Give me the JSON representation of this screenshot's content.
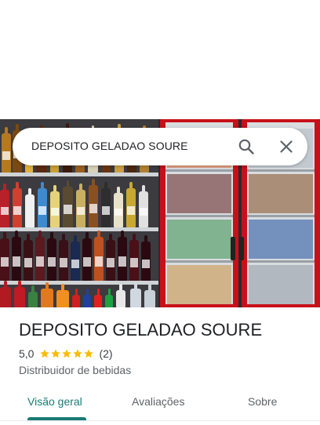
{
  "search": {
    "query": "DEPOSITO GELADAO SOURE",
    "search_icon": "search-icon",
    "close_icon": "close-icon"
  },
  "place": {
    "name": "DEPOSITO GELADAO SOURE",
    "rating_text": "5,0",
    "rating_value": 5.0,
    "stars_total": 5,
    "review_count_text": "(2)",
    "category": "Distribuidor de bebidas"
  },
  "tabs": [
    {
      "label": "Visão geral",
      "active": true
    },
    {
      "label": "Avaliações",
      "active": false
    },
    {
      "label": "Sobre",
      "active": false
    }
  ],
  "colors": {
    "accent": "#1a7a74",
    "star": "#fbbc04",
    "fridge_red": "#c8101a"
  }
}
